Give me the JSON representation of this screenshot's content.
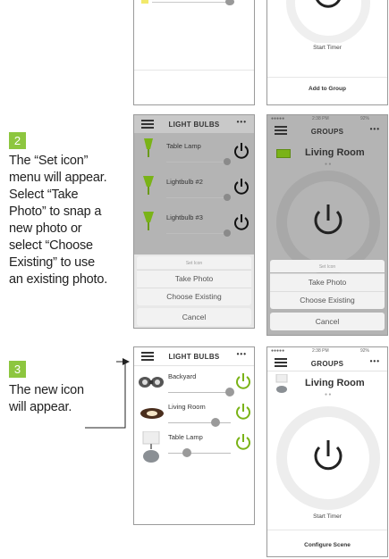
{
  "top_right_phone": {
    "start_timer": "Start Timer",
    "add_to_group": "Add to Group"
  },
  "step2": {
    "number": "2",
    "text_lines": [
      "The “Set icon”",
      "menu will appear.",
      "Select “Take",
      "Photo” to snap a",
      "new photo or",
      "select “Choose",
      "Existing” to use",
      "an existing photo."
    ]
  },
  "step3": {
    "number": "3",
    "text_lines": [
      "The new icon",
      "will appear."
    ]
  },
  "mid_left_phone": {
    "title": "LIGHT BULBS",
    "menu_dots": "•••",
    "items": [
      "Table Lamp",
      "Lightbulb #2",
      "Lightbulb #3"
    ],
    "sheet_title": "Set Icon",
    "take_photo": "Take Photo",
    "choose_existing": "Choose Existing",
    "cancel": "Cancel"
  },
  "mid_right_phone": {
    "status_time": "2:38 PM",
    "status_right": "92%",
    "title": "GROUPS",
    "menu_dots": "•••",
    "room": "Living Room",
    "sheet_title": "Set Icon",
    "take_photo": "Take Photo",
    "choose_existing": "Choose Existing",
    "cancel": "Cancel"
  },
  "bottom_left_phone": {
    "title": "LIGHT BULBS",
    "menu_dots": "•••",
    "items": [
      "Backyard",
      "Living Room",
      "Table Lamp"
    ]
  },
  "bottom_right_phone": {
    "status_time": "2:38 PM",
    "status_right": "92%",
    "title": "GROUPS",
    "menu_dots": "•••",
    "room": "Living Room",
    "start_timer": "Start Timer",
    "configure_scene": "Configure Scene"
  },
  "colors": {
    "accent_green": "#8dc63f",
    "power_green": "#7ab317"
  }
}
